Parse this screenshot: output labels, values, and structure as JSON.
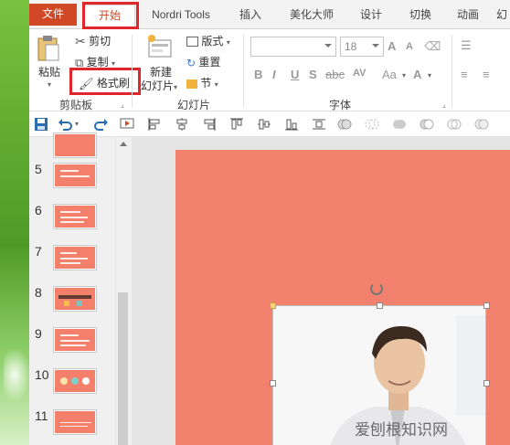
{
  "tabs": {
    "file": "文件",
    "home": "开始",
    "nordri": "Nordri Tools",
    "insert": "插入",
    "beautify": "美化大师",
    "design": "设计",
    "transition": "切换",
    "animation": "动画",
    "more": "幻"
  },
  "clipboard": {
    "paste": "粘贴",
    "cut": "剪切",
    "copy": "复制",
    "format_painter": "格式刷",
    "group": "剪贴板"
  },
  "slides": {
    "new_slide_line1": "新建",
    "new_slide_line2": "幻灯片",
    "layout": "版式",
    "reset": "重置",
    "section": "节",
    "group": "幻灯片"
  },
  "font": {
    "size": "18",
    "bold": "B",
    "italic": "I",
    "underline": "U",
    "strike": "S",
    "spacing": "AV",
    "case": "Aa",
    "color": "A",
    "grow": "A",
    "shrink": "A",
    "group": "字体"
  },
  "thumbnails": [
    "5",
    "6",
    "7",
    "8",
    "9",
    "10",
    "11"
  ],
  "watermark": "爱刨根知识网",
  "colors": {
    "accent": "#d24726",
    "slide_bg": "#f2816d",
    "highlight": "#e0262b"
  }
}
